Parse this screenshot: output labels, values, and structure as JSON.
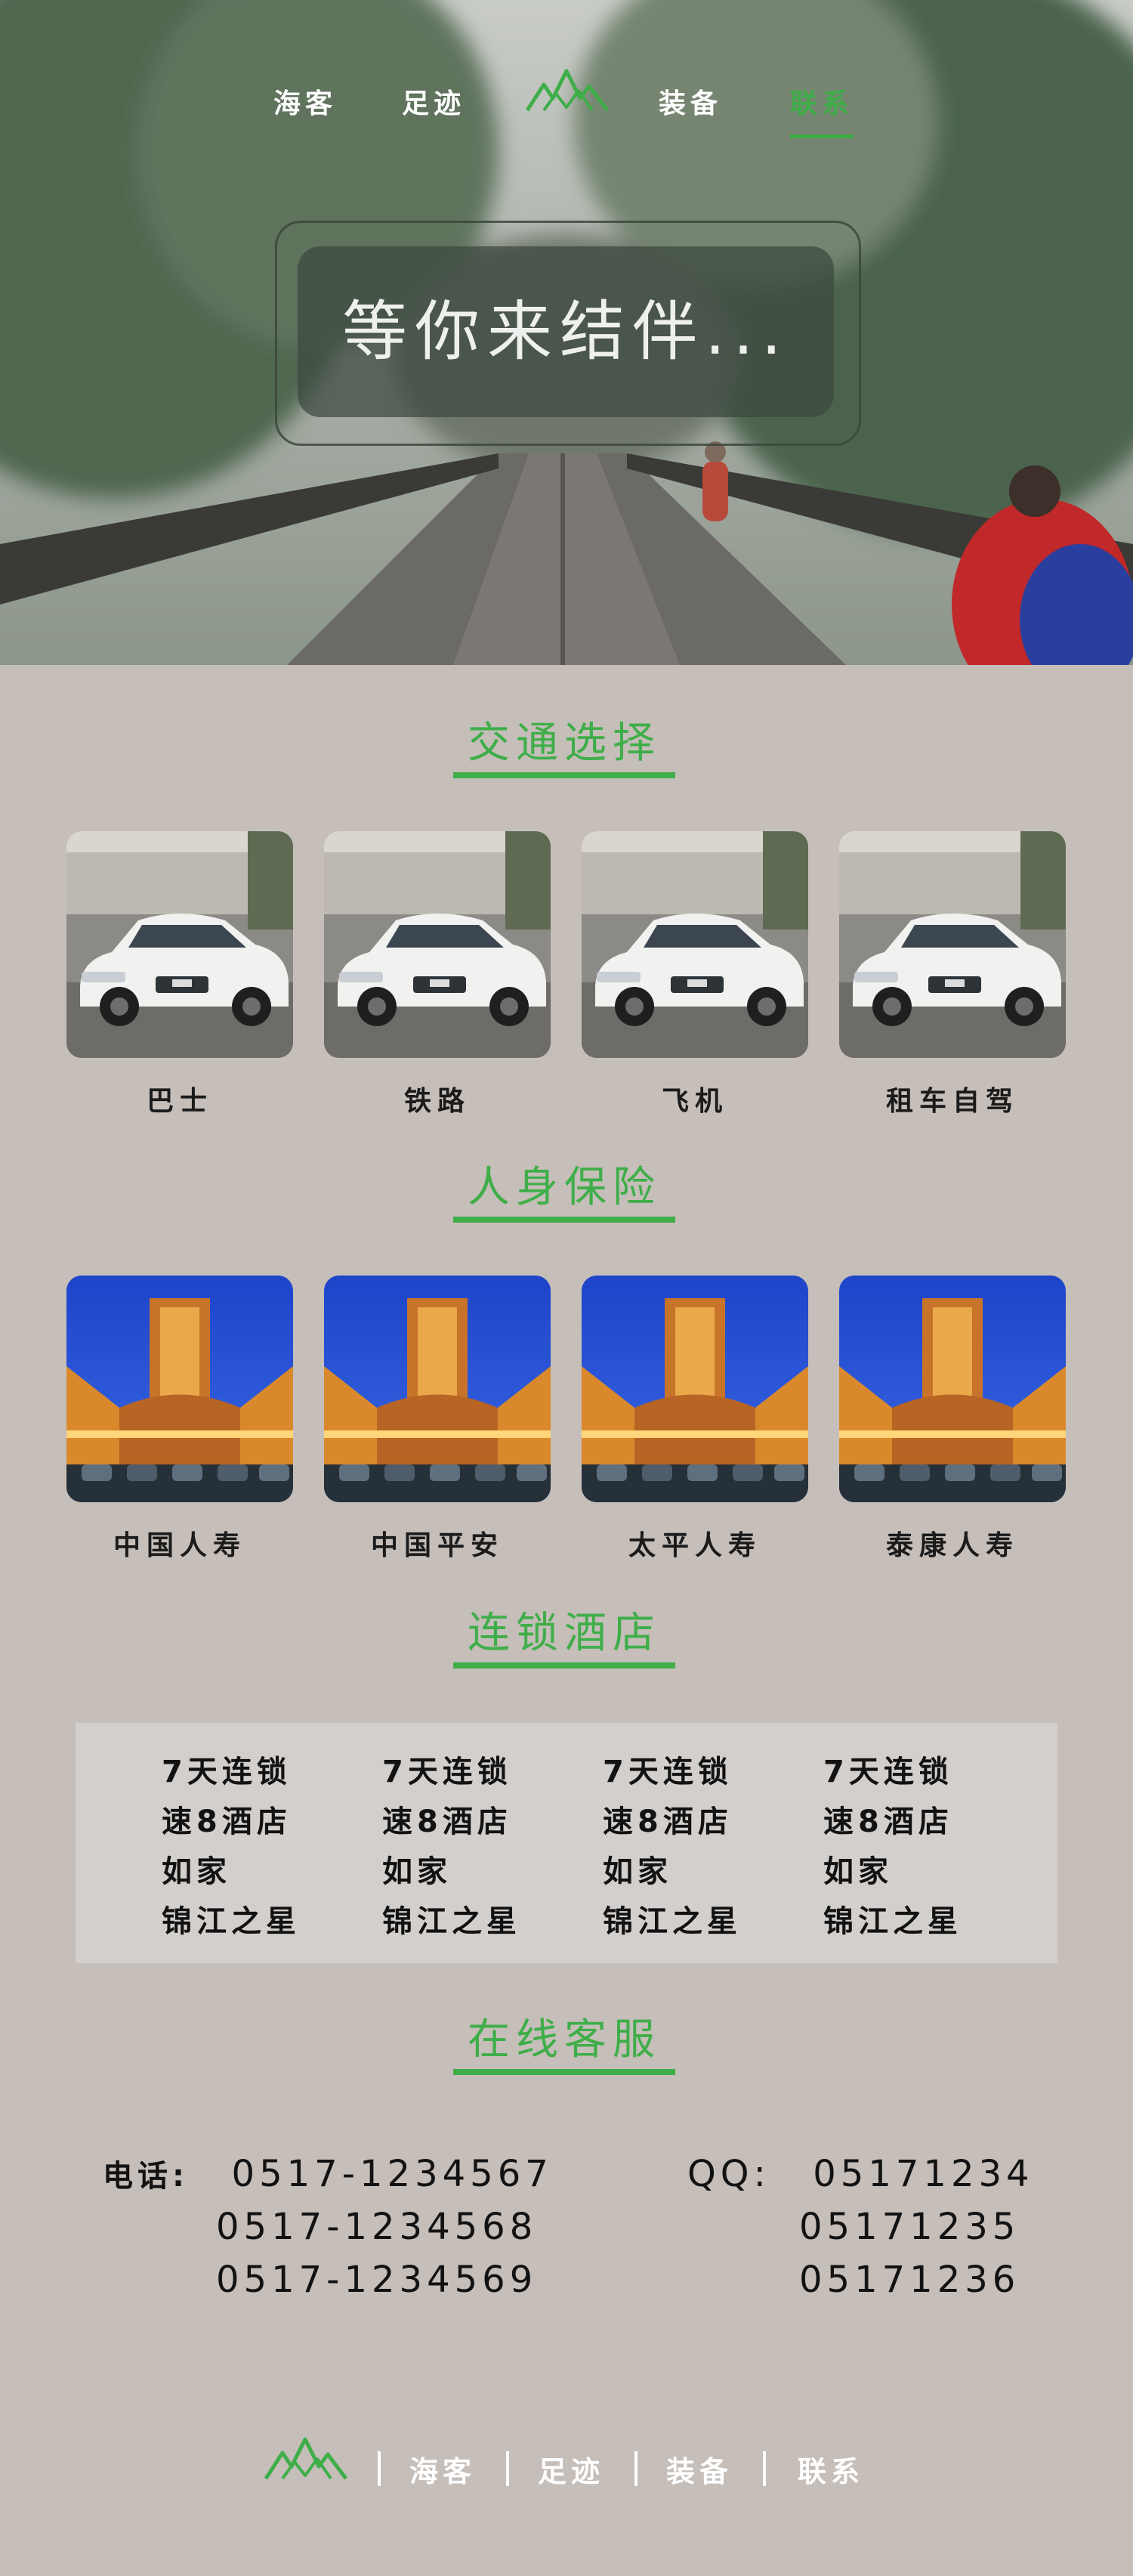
{
  "nav": {
    "left": [
      "海客",
      "足迹"
    ],
    "right": [
      "装备",
      "联系"
    ],
    "active": "联系",
    "logo_icon": "mountain-logo-icon"
  },
  "hero": {
    "slogan": "等你来结伴..."
  },
  "transport": {
    "title": "交通选择",
    "items": [
      {
        "label": "巴士",
        "image": "white-sedan-photo"
      },
      {
        "label": "铁路",
        "image": "white-sedan-photo"
      },
      {
        "label": "飞机",
        "image": "white-sedan-photo"
      },
      {
        "label": "租车自驾",
        "image": "white-sedan-photo"
      }
    ]
  },
  "insurance": {
    "title": "人身保险",
    "items": [
      {
        "label": "中国人寿",
        "image": "lit-building-photo"
      },
      {
        "label": "中国平安",
        "image": "lit-building-photo"
      },
      {
        "label": "太平人寿",
        "image": "lit-building-photo"
      },
      {
        "label": "泰康人寿",
        "image": "lit-building-photo"
      }
    ]
  },
  "hotels": {
    "title": "连锁酒店",
    "columns": [
      [
        "7天连锁",
        "速8酒店",
        "如家",
        "锦江之星"
      ],
      [
        "7天连锁",
        "速8酒店",
        "如家",
        "锦江之星"
      ],
      [
        "7天连锁",
        "速8酒店",
        "如家",
        "锦江之星"
      ],
      [
        "7天连锁",
        "速8酒店",
        "如家",
        "锦江之星"
      ]
    ]
  },
  "service": {
    "title": "在线客服",
    "phone_label": "电话:",
    "phones": [
      "0517-1234567",
      "0517-1234568",
      "0517-1234569"
    ],
    "qq_label": "QQ:",
    "qqs": [
      "05171234",
      "05171235",
      "05171236"
    ]
  },
  "footer": {
    "logo_icon": "mountain-logo-icon",
    "links": [
      "海客",
      "足迹",
      "装备",
      "联系"
    ]
  },
  "colors": {
    "accent": "#3fae49",
    "background": "#c5beb9",
    "panel": "#d3cfcc"
  }
}
